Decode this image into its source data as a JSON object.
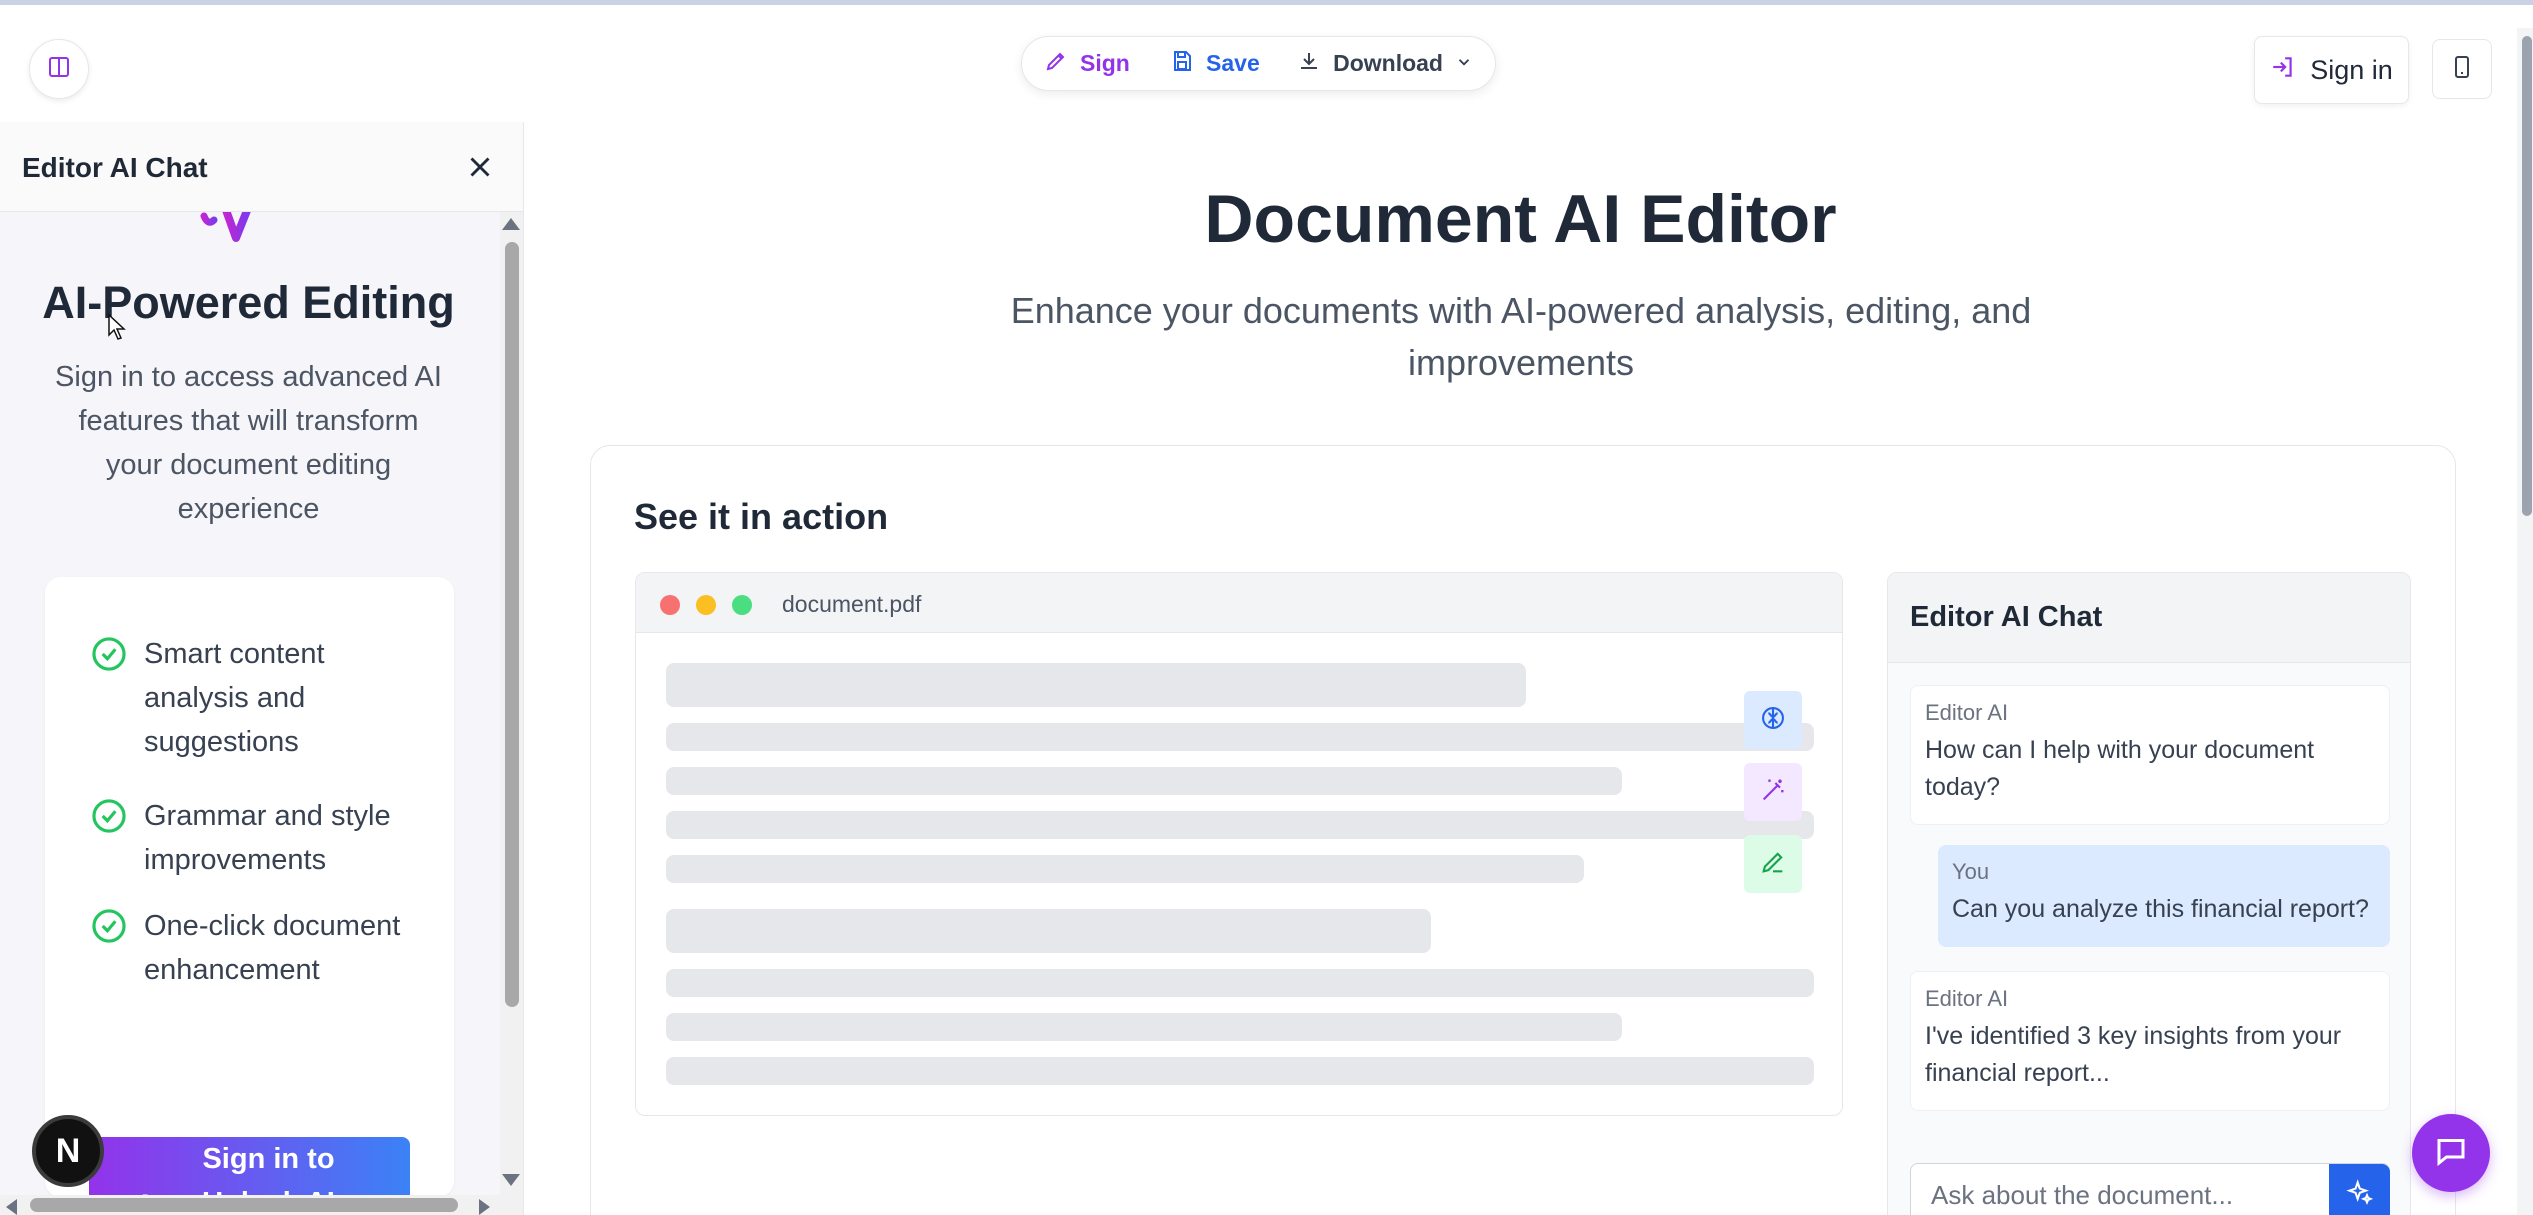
{
  "toolbar": {
    "sign_label": "Sign",
    "save_label": "Save",
    "download_label": "Download"
  },
  "header": {
    "signin_label": "Sign in"
  },
  "sidebar": {
    "title": "Editor AI Chat",
    "heading": "AI-Powered Editing",
    "description": "Sign in to access advanced AI features that will transform your document editing experience",
    "features": [
      "Smart content analysis and suggestions",
      "Grammar and style improvements",
      "One-click document enhancement"
    ],
    "unlock_button": "Sign in to Unlock AI Features"
  },
  "main": {
    "title": "Document AI Editor",
    "subtitle": "Enhance your documents with AI-powered analysis, editing, and improvements",
    "demo_title": "See it in action",
    "document_name": "document.pdf",
    "chat": {
      "title": "Editor AI Chat",
      "messages": [
        {
          "sender": "Editor AI",
          "text": "How can I help with your document today?"
        },
        {
          "sender": "You",
          "text": "Can you analyze this financial report?"
        },
        {
          "sender": "Editor AI",
          "text": "I've identified 3 key insights from your financial report..."
        }
      ],
      "input_placeholder": "Ask about the document..."
    }
  },
  "colors": {
    "purple": "#9333ea",
    "blue": "#2563eb",
    "green": "#22c55e"
  }
}
